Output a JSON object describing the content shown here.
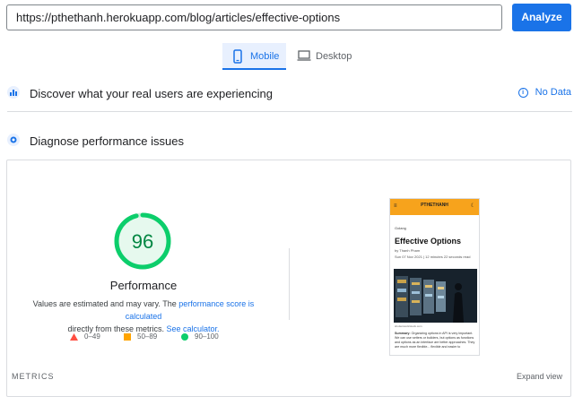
{
  "url_input": {
    "value": "https://pthethanh.herokuapp.com/blog/articles/effective-options"
  },
  "analyze_label": "Analyze",
  "tabs": {
    "mobile": "Mobile",
    "desktop": "Desktop"
  },
  "discover": {
    "title": "Discover what your real users are experiencing",
    "status": "No Data"
  },
  "diagnose": {
    "title": "Diagnose performance issues"
  },
  "score": {
    "value": "96",
    "fraction": 0.96,
    "label": "Performance",
    "color": "#0cce6b"
  },
  "desc": {
    "part1": "Values are estimated and may vary. The ",
    "link1": "performance score is calculated",
    "part2": "directly from these metrics. ",
    "link2": "See calculator."
  },
  "legend": {
    "fail": "0–49",
    "average": "50–89",
    "pass": "90–100"
  },
  "metrics_label": "METRICS",
  "expand_label": "Expand view",
  "preview": {
    "brand": "PTHETHANH",
    "category": "Golang",
    "title": "Effective Options",
    "author": "by Thanh Pham",
    "date": "Sun 07 Nov 2021 | 12 minutes 22 seconds read",
    "caption": "shutterstock/stock.com",
    "summary_label": "Summary:",
    "summary": "Organizing options in API is very important. We can use setters or builders, but options as functions and options as an interface are better approaches. They are much more flexible... flexible and easier to"
  }
}
